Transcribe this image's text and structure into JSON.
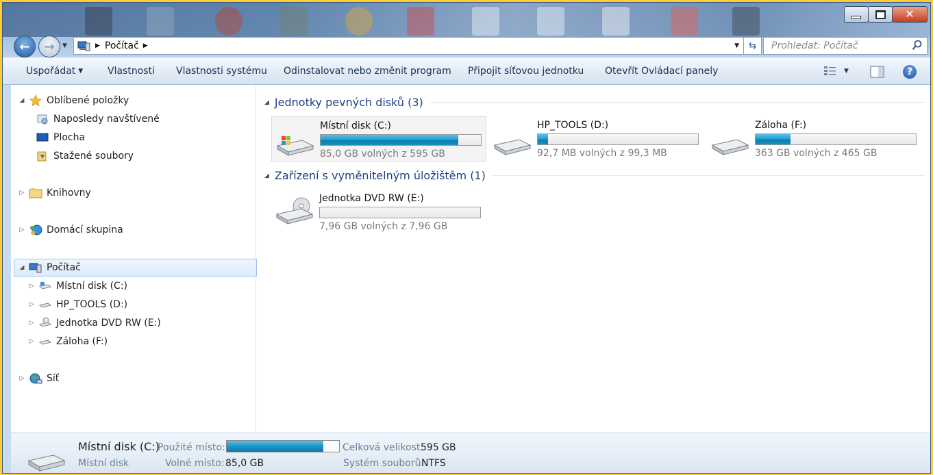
{
  "window": {
    "title": "Počítač"
  },
  "address_bar": {
    "crumbs": [
      "Počítač"
    ]
  },
  "search": {
    "placeholder": "Prohledat: Počítač"
  },
  "toolbar": {
    "organize": "Uspořádat",
    "properties": "Vlastnosti",
    "system_properties": "Vlastnosti systému",
    "uninstall": "Odinstalovat nebo změnit program",
    "map_drive": "Připojit síťovou jednotku",
    "control_panel": "Otevřít Ovládací panely"
  },
  "sidebar": {
    "favorites": {
      "label": "Oblíbené položky",
      "items": [
        "Naposledy navštívené",
        "Plocha",
        "Stažené soubory"
      ]
    },
    "libraries": "Knihovny",
    "homegroup": "Domácí skupina",
    "computer": {
      "label": "Počítač",
      "items": [
        "Místní disk (C:)",
        "HP_TOOLS (D:)",
        "Jednotka DVD RW (E:)",
        "Záloha (F:)"
      ]
    },
    "network": "Síť"
  },
  "groups": [
    {
      "title": "Jednotky pevných disků (3)",
      "drives": [
        {
          "name": "Místní disk (C:)",
          "free_text": "85,0 GB volných z 595 GB",
          "used_fraction": 0.857,
          "selected": true
        },
        {
          "name": "HP_TOOLS (D:)",
          "free_text": "92,7 MB volných z 99,3 MB",
          "used_fraction": 0.066
        },
        {
          "name": "Záloha (F:)",
          "free_text": "363 GB volných z 465 GB",
          "used_fraction": 0.219
        }
      ]
    },
    {
      "title": "Zařízení s vyměnitelným úložištěm (1)",
      "drives": [
        {
          "name": "Jednotka DVD RW (E:)",
          "free_text": "7,96 GB volných z 7,96 GB",
          "used_fraction": 0.0
        }
      ]
    }
  ],
  "details": {
    "name": "Místní disk (C:)",
    "type": "Místní disk",
    "used_label": "Použité místo:",
    "used_fraction": 0.857,
    "free_label": "Volné místo:",
    "free_value": "85,0 GB",
    "total_label": "Celková velikost:",
    "total_value": "595 GB",
    "fs_label": "Systém souborů:",
    "fs_value": "NTFS"
  },
  "colors": {
    "accent": "#1f3f85",
    "bar": "#1991c2"
  }
}
